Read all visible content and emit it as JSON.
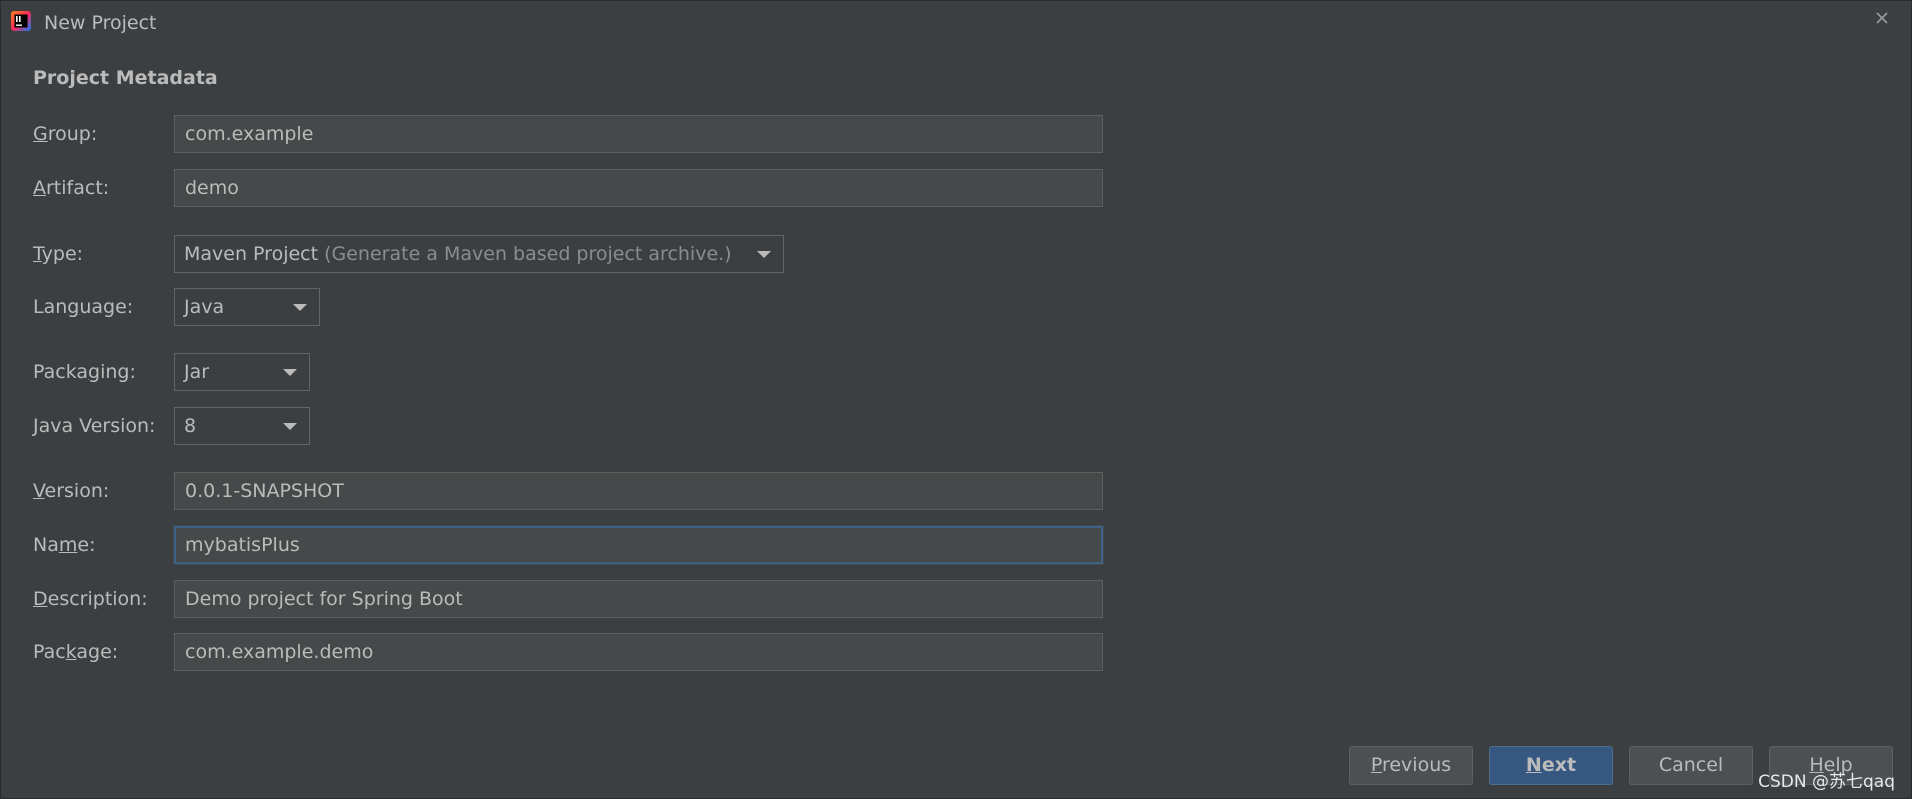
{
  "window": {
    "title": "New Project",
    "app_icon": "intellij-idea-icon",
    "close_icon": "close-icon"
  },
  "section": {
    "title": "Project Metadata"
  },
  "fields": {
    "group": {
      "mnemonic": "G",
      "label_rest": "roup:",
      "value": "com.example"
    },
    "artifact": {
      "mnemonic": "A",
      "label_rest": "rtifact:",
      "value": "demo"
    },
    "type": {
      "mnemonic": "T",
      "label_rest": "ype:",
      "value": "Maven Project",
      "hint": "(Generate a Maven based project archive.)"
    },
    "language": {
      "pre": "Lan",
      "mnemonic": "g",
      "label_rest": "uage:",
      "value": "Java"
    },
    "packaging": {
      "pre": "Packa",
      "mnemonic": "g",
      "label_rest": "ing:",
      "value": "Jar"
    },
    "java_version": {
      "mnemonic": "J",
      "label_rest": "ava Version:",
      "value": "8"
    },
    "version": {
      "mnemonic": "V",
      "label_rest": "ersion:",
      "value": "0.0.1-SNAPSHOT"
    },
    "name": {
      "pre": "Na",
      "mnemonic": "m",
      "label_rest": "e:",
      "value": "mybatisPlus"
    },
    "description": {
      "mnemonic": "D",
      "label_rest": "escription:",
      "value": "Demo project for Spring Boot"
    },
    "package": {
      "pre": "Pac",
      "mnemonic": "k",
      "label_rest": "age:",
      "value": "com.example.demo"
    }
  },
  "buttons": {
    "previous": {
      "mnemonic": "P",
      "rest": "revious"
    },
    "next": {
      "mnemonic": "N",
      "rest": "ext"
    },
    "cancel": {
      "label": "Cancel"
    },
    "help": {
      "mnemonic": "H",
      "rest": "elp"
    }
  },
  "watermark": "CSDN @苏七qaq",
  "colors": {
    "background": "#3c3f41",
    "field_bg": "#45494a",
    "focus_border": "#3d6185",
    "primary_button": "#365880",
    "text": "#bbbbbb"
  }
}
